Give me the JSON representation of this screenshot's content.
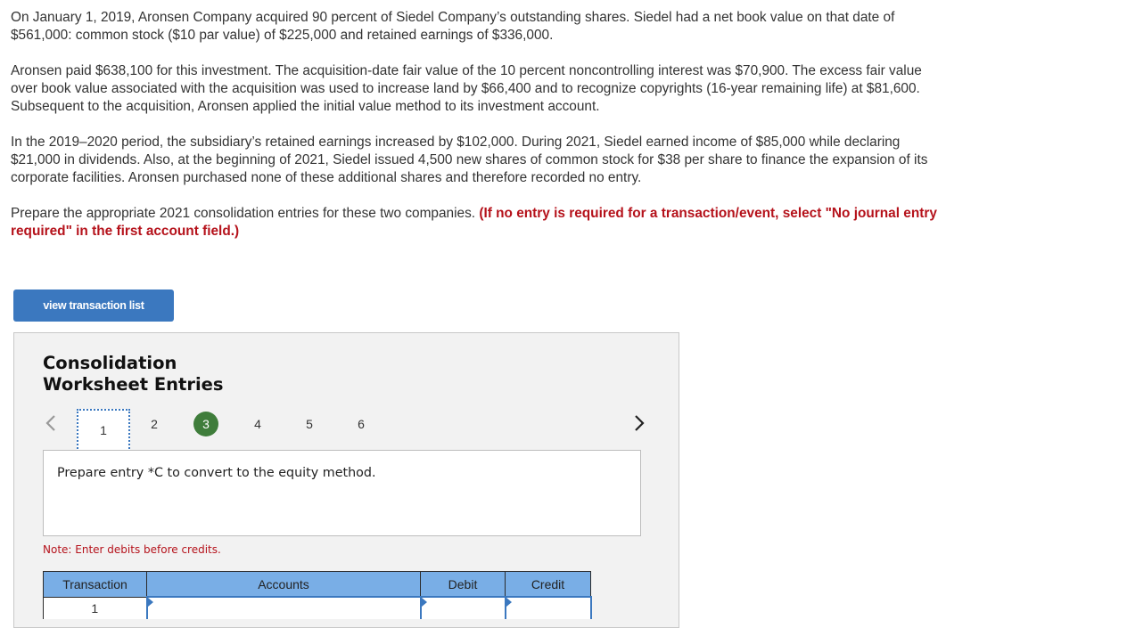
{
  "problem": {
    "paragraphs": [
      "On January 1, 2019, Aronsen Company acquired 90 percent of Siedel Company’s outstanding shares. Siedel had a net book value on that date of $561,000: common stock ($10 par value) of $225,000 and retained earnings of $336,000.",
      "Aronsen paid $638,100 for this investment. The acquisition-date fair value of the 10 percent noncontrolling interest was $70,900. The excess fair value over book value associated with the acquisition was used to increase land by $66,400 and to recognize copyrights (16-year remaining life) at $81,600. Subsequent to the acquisition, Aronsen applied the initial value method to its investment account.",
      "In the 2019–2020 period, the subsidiary’s retained earnings increased by $102,000. During 2021, Siedel earned income of $85,000 while declaring $21,000 in dividends. Also, at the beginning of 2021, Siedel issued 4,500 new shares of common stock for $38 per share to finance the expansion of its corporate facilities. Aronsen purchased none of these additional shares and therefore recorded no entry."
    ],
    "instruction": "Prepare the appropriate 2021 consolidation entries for these two companies.",
    "instruction_note": "(If no entry is required for a transaction/event, select \"No journal entry required\" in the first account field.)"
  },
  "buttons": {
    "view_transaction_list": "view transaction list"
  },
  "panel": {
    "title_line1": "Consolidation",
    "title_line2": "Worksheet Entries",
    "nav": {
      "prev_icon": "chevron-left-icon",
      "next_icon": "chevron-right-icon",
      "pages": [
        "1",
        "2",
        "3",
        "4",
        "5",
        "6"
      ],
      "selected_page": "1",
      "completed_page": "3"
    },
    "prompt": "Prepare entry *C to convert to the equity method.",
    "note": "Note: Enter debits before credits.",
    "table": {
      "headers": [
        "Transaction",
        "Accounts",
        "Debit",
        "Credit"
      ],
      "rows": [
        {
          "transaction": "1",
          "account": "",
          "debit": "",
          "credit": ""
        }
      ]
    }
  },
  "colors": {
    "accent_blue": "#3b78bf",
    "header_blue": "#79aee6",
    "completed_green": "#3f7d3b",
    "warning_red": "#b5121b"
  }
}
